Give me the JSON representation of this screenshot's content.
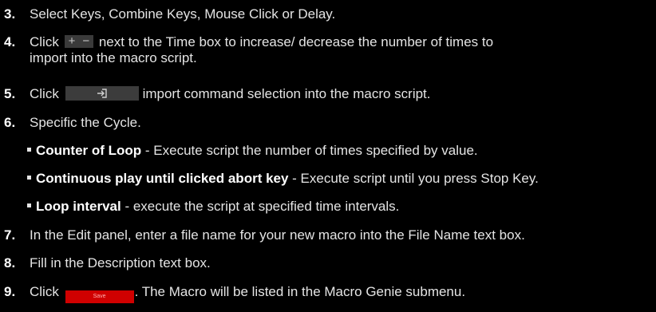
{
  "steps": [
    {
      "num": "3.",
      "text": "Select Keys, Combine Keys, Mouse Click or Delay."
    },
    {
      "num": "4.",
      "pre": "Click",
      "post": "next to the Time box to increase/ decrease the number of times to",
      "line2": "import into the macro script."
    },
    {
      "num": "5.",
      "pre": "Click",
      "post": "import command selection into the macro script."
    },
    {
      "num": "6.",
      "text": "Specific the Cycle."
    },
    {
      "num": "7.",
      "text": "In the Edit panel, enter a file name for your new macro into the File Name text box."
    },
    {
      "num": "8.",
      "text": "Fill in the Description text box."
    },
    {
      "num": "9.",
      "pre": "Click",
      "post": ". The Macro will be listed in the Macro Genie submenu."
    }
  ],
  "bullets": [
    {
      "term": "Counter of Loop",
      "desc": " - Execute script the number of times specified by value."
    },
    {
      "term": "Continuous play until clicked abort key",
      "desc": " -  Execute script until you press Stop Key."
    },
    {
      "term": "Loop interval",
      "desc": " - execute the script at specified time intervals."
    }
  ],
  "widgets": {
    "plus": "+",
    "minus": "−",
    "save_label": "Save",
    "save_color": "#d00000",
    "import_icon": "import-arrow-icon"
  }
}
